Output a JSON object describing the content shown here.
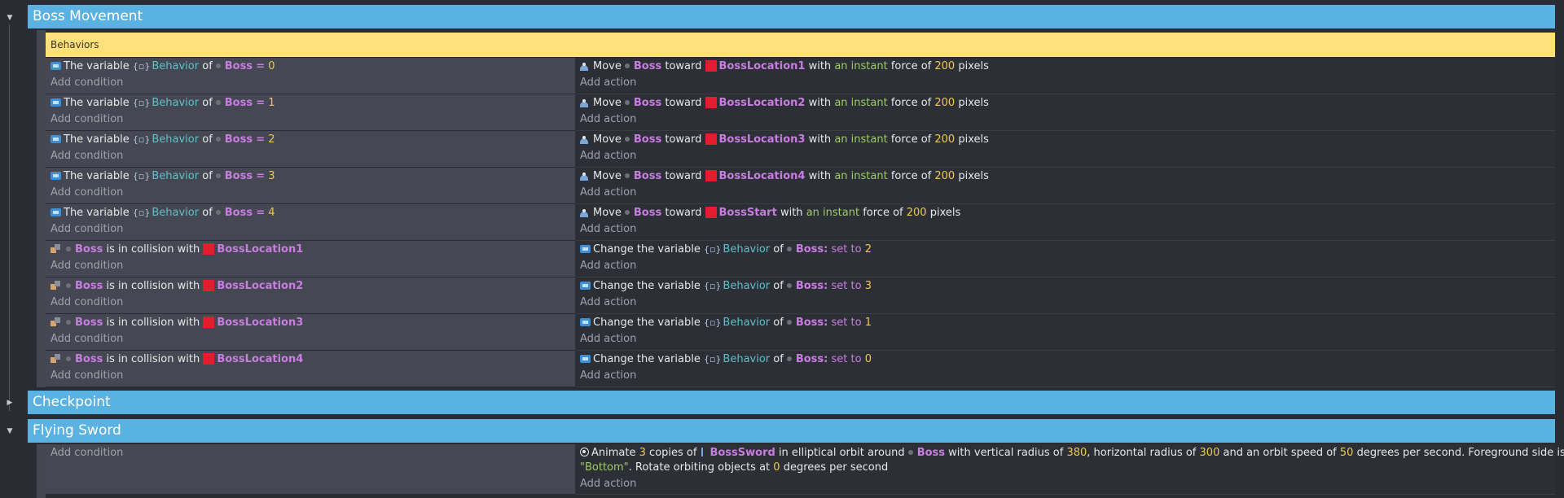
{
  "groups": [
    {
      "name": "Boss Movement",
      "expanded": true
    },
    {
      "name": "Checkpoint",
      "expanded": false
    },
    {
      "name": "Flying Sword",
      "expanded": true
    }
  ],
  "comment": "Behaviors",
  "add_condition": "Add condition",
  "add_action": "Add action",
  "words": {
    "the_variable": "The variable",
    "behavior": "Behavior",
    "of": "of",
    "boss": "Boss",
    "eq": "=",
    "move": "Move",
    "toward": "toward",
    "with": "with",
    "an_instant": "an instant",
    "force_of": "force of",
    "pixels": "pixels",
    "is_in_collision_with": "is in collision with",
    "change_the_variable": "Change the variable",
    "colon": ":",
    "set_to": "set to"
  },
  "var_events": [
    {
      "value": "0",
      "target": "BossLocation1",
      "force": "200"
    },
    {
      "value": "1",
      "target": "BossLocation2",
      "force": "200"
    },
    {
      "value": "2",
      "target": "BossLocation3",
      "force": "200"
    },
    {
      "value": "3",
      "target": "BossLocation4",
      "force": "200"
    },
    {
      "value": "4",
      "target": "BossStart",
      "force": "200"
    }
  ],
  "collision_events": [
    {
      "target": "BossLocation1",
      "set_to": "2"
    },
    {
      "target": "BossLocation2",
      "set_to": "3"
    },
    {
      "target": "BossLocation3",
      "set_to": "1"
    },
    {
      "target": "BossLocation4",
      "set_to": "0"
    }
  ],
  "orbit_action": {
    "animate": "Animate",
    "copies": "3",
    "copies_of": "copies of",
    "object": "BossSword",
    "orbit_around": "in elliptical orbit around",
    "center": "Boss",
    "vr_label": "with vertical radius of",
    "vr": "380",
    "hr_label": ", horizontal radius of",
    "hr": "300",
    "speed_label": "and an orbit speed of",
    "speed": "50",
    "fg_label": "degrees per second. Foreground side is",
    "fg": "\"Bottom\"",
    "rot_label": ". Rotate orbiting objects at",
    "rot": "0",
    "rot_unit": "degrees per second"
  },
  "colors": {
    "group_header": "#5ab2e2",
    "comment": "#ffe17c",
    "object": "#c87de0",
    "variable": "#5ec0c8",
    "number": "#f2c94c",
    "string": "#9ccc65",
    "object_icon_red": "#e11d2e"
  }
}
